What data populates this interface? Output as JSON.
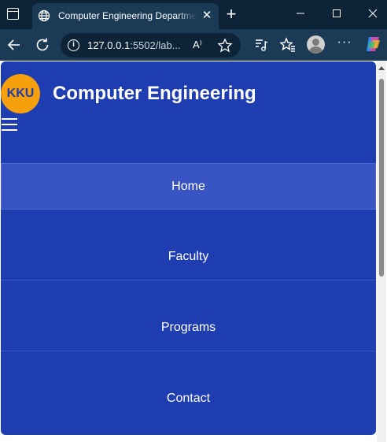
{
  "browser": {
    "tab_title": "Computer Engineering Department",
    "url_host": "127.0.0.1",
    "url_rest": ":5502/lab...",
    "read_aloud_label": "A⁾",
    "icons": [
      "window-icon",
      "globe-icon",
      "close-icon",
      "plus-icon",
      "minimize-icon",
      "maximize-icon",
      "close-window-icon",
      "back-icon",
      "refresh-icon",
      "info-icon",
      "read-aloud-icon",
      "favorite-star-icon",
      "media-icon",
      "favorites-icon",
      "profile-icon",
      "more-icon",
      "copilot-icon"
    ]
  },
  "site": {
    "logo_text": "KKU",
    "title": "Computer Engineering",
    "menu_icon": "☰",
    "nav": [
      {
        "label": "Home",
        "active": true
      },
      {
        "label": "Faculty",
        "active": false
      },
      {
        "label": "Programs",
        "active": false
      },
      {
        "label": "Contact",
        "active": false
      }
    ],
    "colors": {
      "primary": "#1e3db0",
      "logo": "#f5a00c",
      "active": "#3853c2"
    }
  }
}
